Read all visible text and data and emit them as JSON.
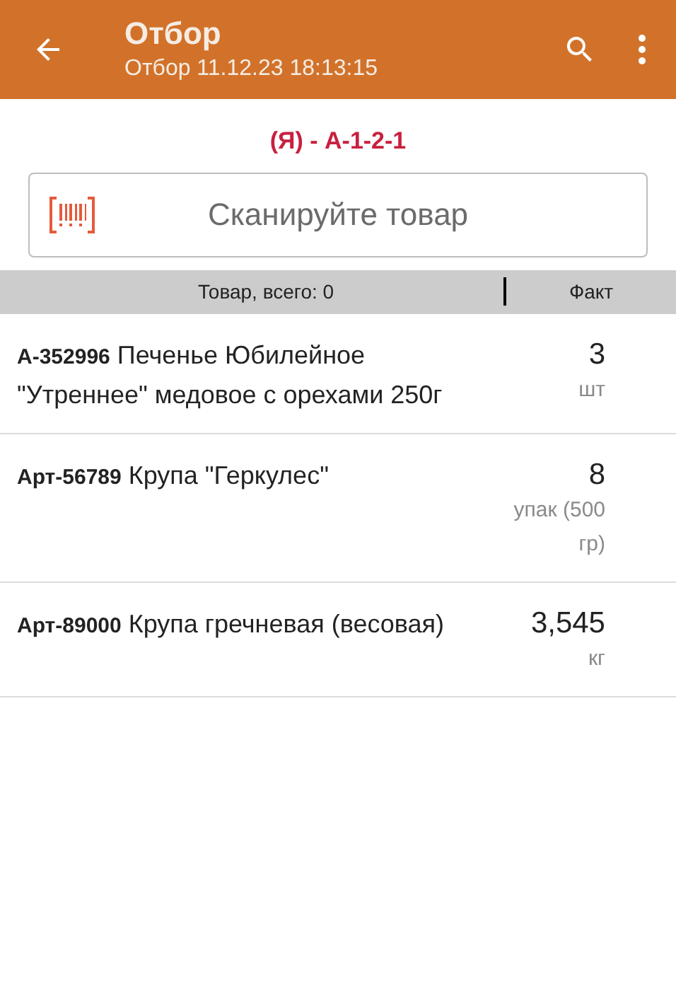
{
  "app_bar": {
    "title": "Отбор",
    "subtitle": "Отбор 11.12.23 18:13:15"
  },
  "location": "(Я) - А-1-2-1",
  "scan_field": {
    "placeholder": "Сканируйте товар"
  },
  "table": {
    "columns": [
      "Товар, всего: 0",
      "Факт"
    ],
    "rows": [
      {
        "name": "**А-352996** Печенье Юбилейное \"Утреннее\" медовое с орехами 250г",
        "quantity": "3",
        "unit": "шт"
      },
      {
        "name": "**Арт-56789** Крупа \"Геркулес\"",
        "quantity": "8",
        "unit": "упак (500 гр)"
      },
      {
        "name": "**Арт-89000** Крупа гречневая (весовая)",
        "quantity": "3,545",
        "unit": "кг"
      }
    ]
  }
}
